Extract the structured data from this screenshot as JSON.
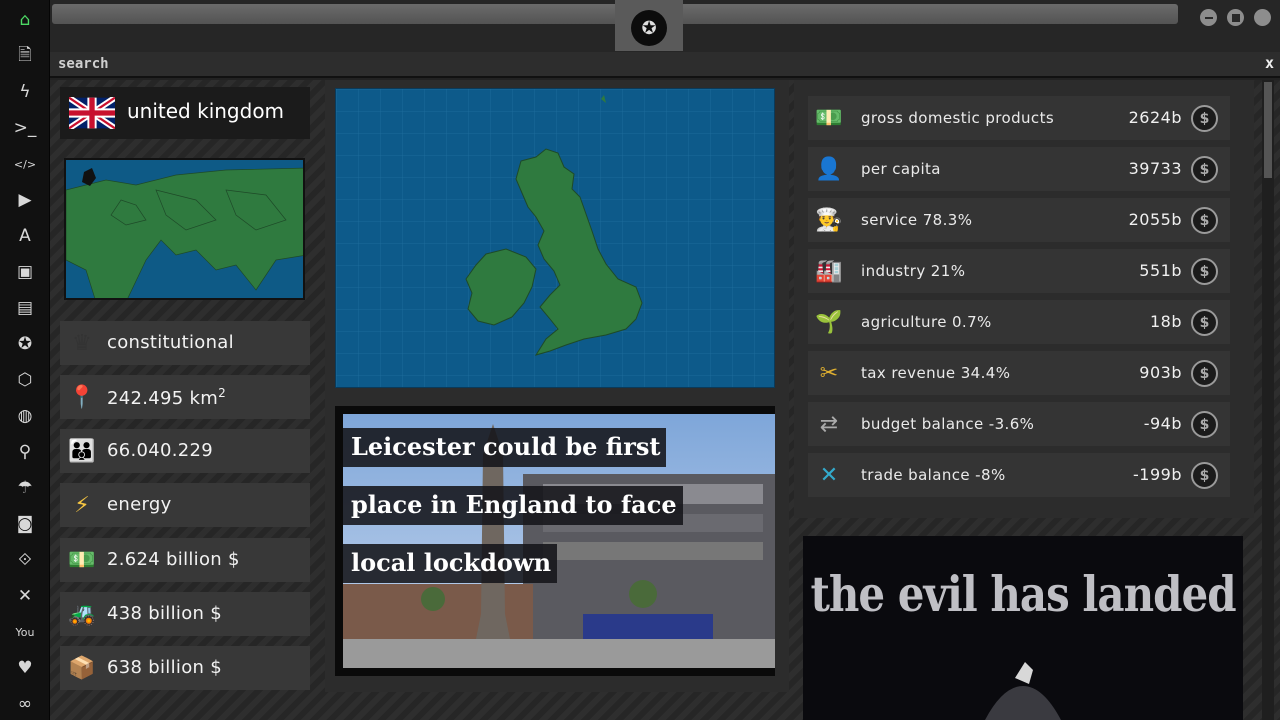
{
  "sidebar": {
    "items": [
      {
        "name": "home-icon",
        "glyph": "⌂"
      },
      {
        "name": "document-icon",
        "glyph": "🗎"
      },
      {
        "name": "lightning-icon",
        "glyph": "ϟ"
      },
      {
        "name": "terminal-icon",
        "glyph": ">_"
      },
      {
        "name": "code-icon",
        "glyph": "</>"
      },
      {
        "name": "play-icon",
        "glyph": "▶"
      },
      {
        "name": "translate-icon",
        "glyph": "A"
      },
      {
        "name": "image-icon",
        "glyph": "▣"
      },
      {
        "name": "newspaper-icon",
        "glyph": "▤"
      },
      {
        "name": "rebel-icon",
        "glyph": "✪"
      },
      {
        "name": "hexagon-icon",
        "glyph": "⬡"
      },
      {
        "name": "globe-icon",
        "glyph": "◍"
      },
      {
        "name": "search-icon",
        "glyph": "⚲"
      },
      {
        "name": "umbrella-icon",
        "glyph": "☂"
      },
      {
        "name": "contact-icon",
        "glyph": "◙"
      },
      {
        "name": "link-icon",
        "glyph": "⟐"
      },
      {
        "name": "expand-icon",
        "glyph": "✕"
      },
      {
        "name": "youtube-icon",
        "glyph": "You"
      },
      {
        "name": "heart-icon",
        "glyph": "♥"
      },
      {
        "name": "infinity-icon",
        "glyph": "∞"
      }
    ]
  },
  "search": {
    "label": "search",
    "close": "x"
  },
  "country": {
    "name": "united kingdom",
    "stats": [
      {
        "name": "government-type",
        "icon": "crown-icon",
        "text": "constitutional"
      },
      {
        "name": "area",
        "icon": "map-pin-icon",
        "text": "242.495 km",
        "sup": "2"
      },
      {
        "name": "population",
        "icon": "people-icon",
        "text": "66.040.229"
      },
      {
        "name": "primary-sector",
        "icon": "lightning-icon",
        "text": "energy"
      },
      {
        "name": "gdp",
        "icon": "money-stack-icon",
        "text": "2.624 billion $"
      },
      {
        "name": "imports",
        "icon": "forklift-icon",
        "text": "438 billion $"
      },
      {
        "name": "exports",
        "icon": "boxes-icon",
        "text": "638 billion $"
      }
    ]
  },
  "news": {
    "headline_lines": [
      "Leicester could be first",
      "place in England to face",
      "local lockdown"
    ]
  },
  "indicators": [
    {
      "name": "gdp",
      "icon": "money-stack-icon",
      "label": "gross domestic products",
      "value": "2624b"
    },
    {
      "name": "per-capita",
      "icon": "person-icon",
      "label": "per capita",
      "value": "39733"
    },
    {
      "name": "service",
      "icon": "chef-icon",
      "label": "service 78.3%",
      "value": "2055b"
    },
    {
      "name": "industry",
      "icon": "factory-icon",
      "label": "industry 21%",
      "value": "551b"
    },
    {
      "name": "agriculture",
      "icon": "plant-icon",
      "label": "agriculture 0.7%",
      "value": "18b"
    },
    {
      "name": "tax-revenue",
      "icon": "scissors-money-icon",
      "label": "tax revenue 34.4%",
      "value": "903b"
    },
    {
      "name": "budget-balance",
      "icon": "arrows-exchange-icon",
      "label": "budget balance -3.6%",
      "value": "-94b"
    },
    {
      "name": "trade-balance",
      "icon": "cross-trend-icon",
      "label": "trade balance -8%",
      "value": "-199b"
    }
  ],
  "coin_glyph": "$",
  "promo": {
    "text": "the evil has landed"
  },
  "colors": {
    "sea": "#0d5a8a",
    "land": "#2f7a3f",
    "panel": "#2c2c2c"
  }
}
